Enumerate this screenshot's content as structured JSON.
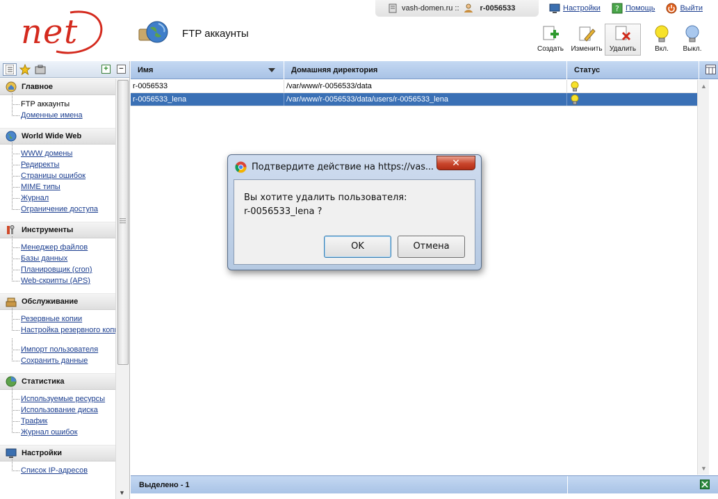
{
  "header": {
    "page_title": "FTP аккаунты",
    "domain_label": "vash-domen.ru ::",
    "user_login": "r-0056533",
    "links": {
      "settings": "Настройки",
      "help": "Помощь",
      "logout": "Выйти"
    }
  },
  "toolbar": {
    "create": "Создать",
    "edit": "Изменить",
    "delete": "Удалить",
    "enable": "Вкл.",
    "disable": "Выкл."
  },
  "sidebar": {
    "groups": [
      {
        "title": "Главное",
        "icon": "home-icon",
        "items": [
          "FTP аккаунты",
          "Доменные имена"
        ]
      },
      {
        "title": "World Wide Web",
        "icon": "globe-icon",
        "items": [
          "WWW домены",
          "Редиректы",
          "Страницы ошибок",
          "MIME типы",
          "Журнал",
          "Ограничение доступа"
        ]
      },
      {
        "title": "Инструменты",
        "icon": "tools-icon",
        "items": [
          "Менеджер файлов",
          "Базы данных",
          "Планировщик (cron)",
          "Web-скрипты (APS)"
        ]
      },
      {
        "title": "Обслуживание",
        "icon": "maintenance-icon",
        "items": [
          "Резервные копии",
          "Настройка резервного копирования",
          "Импорт пользователя",
          "Сохранить данные"
        ]
      },
      {
        "title": "Статистика",
        "icon": "statistics-icon",
        "items": [
          "Используемые ресурсы",
          "Использование диска",
          "Трафик",
          "Журнал ошибок"
        ]
      },
      {
        "title": "Настройки",
        "icon": "settings-icon",
        "items": [
          "Список IP-адресов"
        ]
      }
    ]
  },
  "grid": {
    "columns": [
      "Имя",
      "Домашняя директория",
      "Статус"
    ],
    "rows": [
      {
        "name": "r-0056533",
        "home": "/var/www/r-0056533/data",
        "status": "enabled"
      },
      {
        "name": "r-0056533_lena",
        "home": "/var/www/r-0056533/data/users/r-0056533_lena",
        "status": "enabled"
      }
    ],
    "selected_label": "Выделено - 1"
  },
  "dialog": {
    "title": "Подтвердите действие на https://vas...",
    "message_line1": "Вы хотите удалить пользователя:",
    "message_line2": "r-0056533_lena ?",
    "ok": "OK",
    "cancel": "Отмена"
  },
  "colors": {
    "selected_row": "#3a70b5",
    "grid_header": "#b8cfec",
    "logo_red": "#d42a1e",
    "link": "#1a3d8f"
  }
}
